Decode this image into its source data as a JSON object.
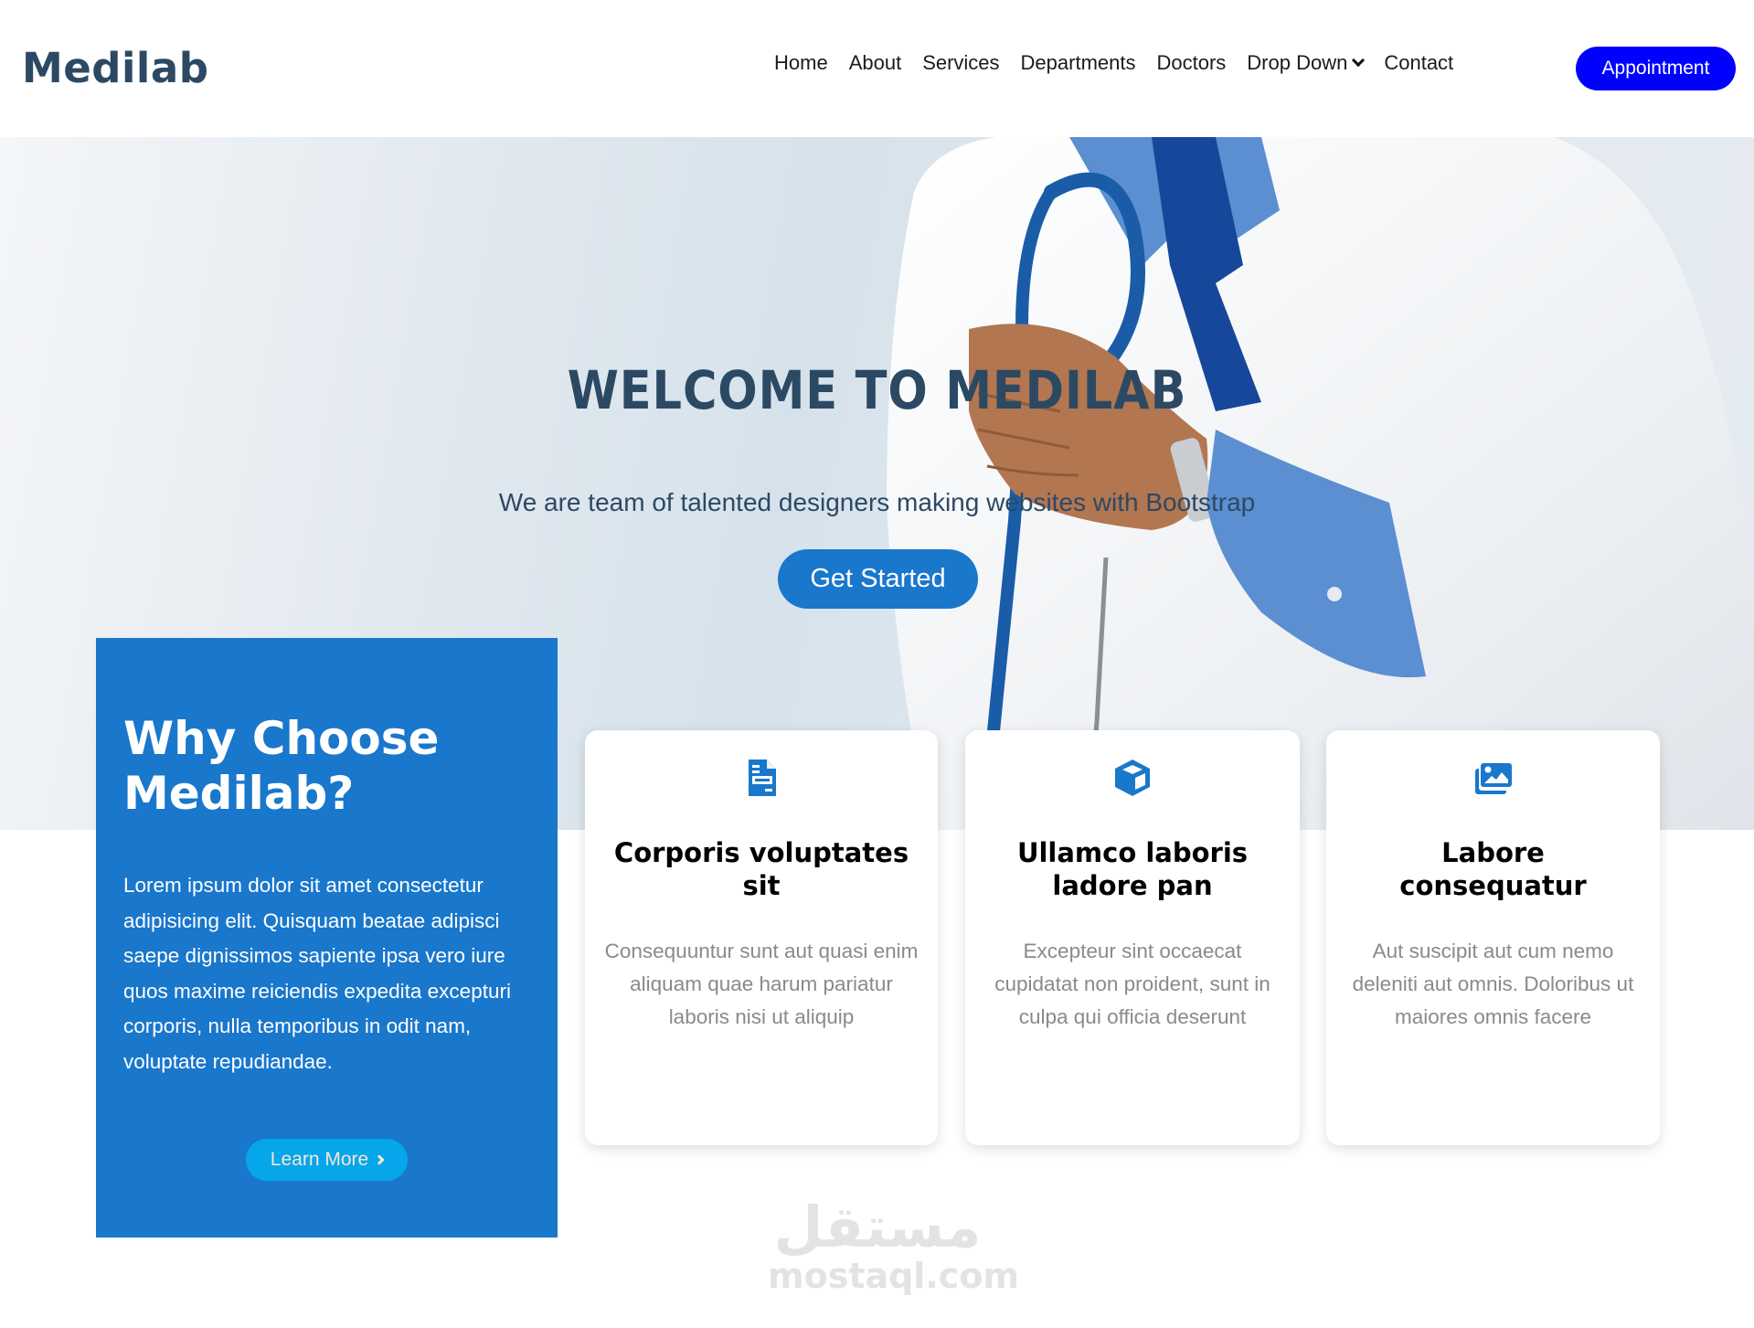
{
  "header": {
    "logo": "Medilab",
    "nav": [
      "Home",
      "About",
      "Services",
      "Departments",
      "Doctors",
      "Drop Down",
      "Contact"
    ],
    "appointment_label": "Appointment"
  },
  "hero": {
    "title": "WELCOME TO MEDILAB",
    "subtitle": "We are team of talented designers making websites with Bootstrap",
    "cta_label": "Get Started"
  },
  "why": {
    "title": "Why Choose Medilab?",
    "text": "Lorem ipsum dolor sit amet consectetur adipisicing elit. Quisquam beatae adipisci saepe dignissimos sapiente ipsa vero iure quos maxime reiciendis expedita excepturi corporis, nulla temporibus in odit nam, voluptate repudiandae.",
    "button_label": "Learn More"
  },
  "cards": [
    {
      "icon": "document-icon",
      "title": "Corporis voluptates sit",
      "text": "Consequuntur sunt aut quasi enim aliquam quae harum pariatur laboris nisi ut aliquip"
    },
    {
      "icon": "cube-icon",
      "title": "Ullamco laboris ladore pan",
      "text": "Excepteur sint occaecat cupidatat non proident, sunt in culpa qui officia deserunt"
    },
    {
      "icon": "images-icon",
      "title": "Labore consequatur",
      "text": "Aut suscipit aut cum nemo deleniti aut omnis. Doloribus ut maiores omnis facere"
    }
  ],
  "watermark": {
    "arabic": "مستقل",
    "latin": "mostaql.com"
  },
  "colors": {
    "brand_dark": "#2c4964",
    "primary": "#1977cc",
    "appointment": "#0000ff",
    "learn_more": "#06a6ea"
  }
}
